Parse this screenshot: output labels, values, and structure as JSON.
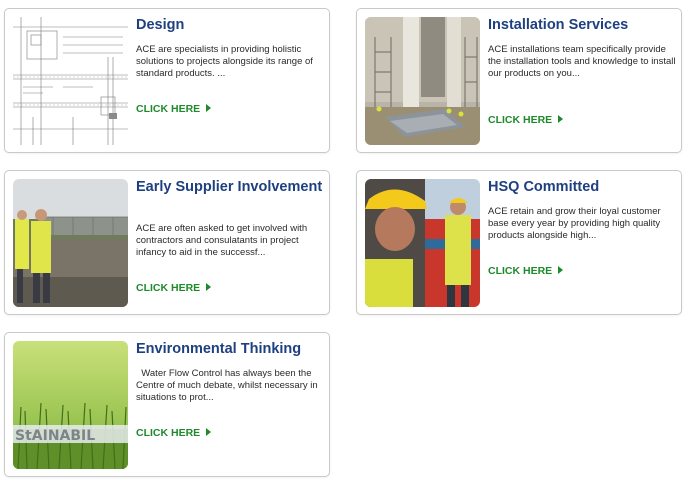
{
  "cards": [
    {
      "title": "Design",
      "description": "ACE are specialists in providing holistic solutions to projects alongside its range of standard products. ...",
      "cta": "CLICK HERE",
      "image": "technical-drawing-image"
    },
    {
      "title": "Installation Services",
      "description": "ACE installations team specifically provide the installation tools and knowledge to install our products on you...",
      "cta": "CLICK HERE",
      "image": "installation-site-image"
    },
    {
      "title": "Early Supplier Involvement",
      "description": "ACE are often asked to get involved with contractors and consulatants in project infancy to aid in the successf...",
      "cta": "CLICK HERE",
      "image": "site-workers-image"
    },
    {
      "title": "HSQ Committed",
      "description": "ACE retain and grow their loyal customer base every year by providing high quality products alongside high...",
      "cta": "CLICK HERE",
      "image": "hard-hat-worker-image"
    },
    {
      "title": "Environmental Thinking",
      "description": "  Water Flow Control has always been the Centre of much debate, whilst necessary in situations to prot...",
      "cta": "CLICK HERE",
      "image": "sustainability-grass-image",
      "image_text": "StAINABIL"
    }
  ],
  "colors": {
    "title": "#1e3f80",
    "cta": "#1f8a2c",
    "border": "#c9c9c9"
  }
}
